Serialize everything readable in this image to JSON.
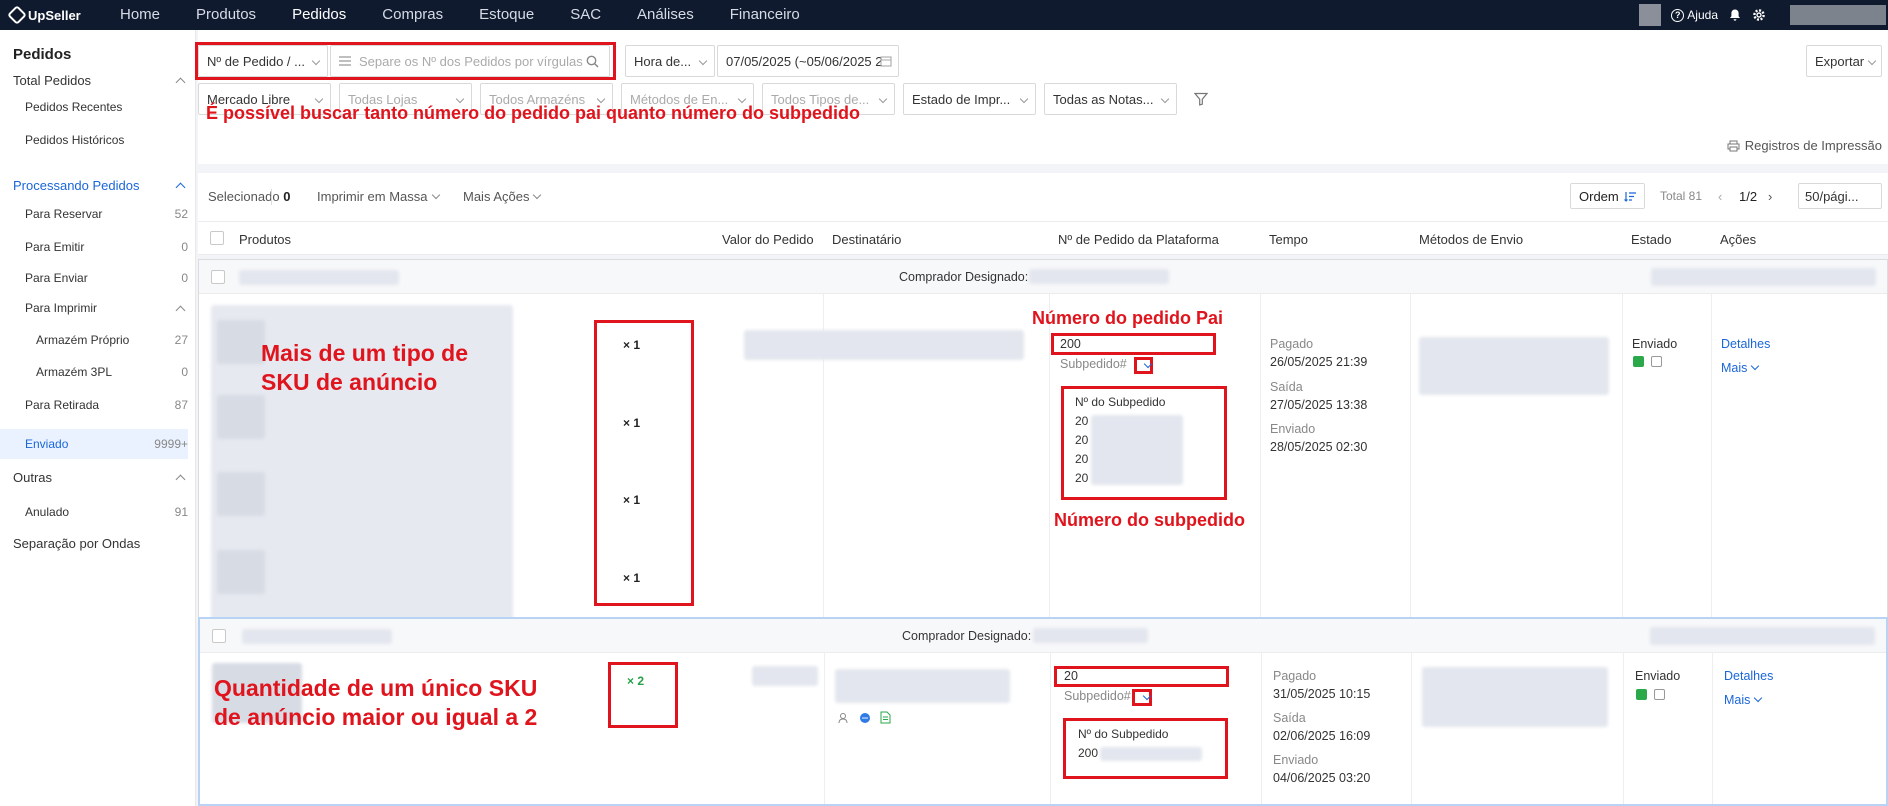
{
  "nav": {
    "logo": "UpSeller",
    "items": [
      "Home",
      "Produtos",
      "Pedidos",
      "Compras",
      "Estoque",
      "SAC",
      "Análises",
      "Financeiro"
    ],
    "active": "Pedidos",
    "help": "Ajuda"
  },
  "sidebar": {
    "title": "Pedidos",
    "total": "Total Pedidos",
    "recentes": "Pedidos Recentes",
    "historicos": "Pedidos Históricos",
    "processando": "Processando Pedidos",
    "reservar": {
      "label": "Para Reservar",
      "count": "52"
    },
    "emitir": {
      "label": "Para Emitir",
      "count": "0"
    },
    "enviar": {
      "label": "Para Enviar",
      "count": "0"
    },
    "imprimir": "Para Imprimir",
    "armazem_proprio": {
      "label": "Armazém Próprio",
      "count": "27"
    },
    "armazem_3pl": {
      "label": "Armazém 3PL",
      "count": "0"
    },
    "retirada": {
      "label": "Para Retirada",
      "count": "87"
    },
    "enviado": {
      "label": "Enviado",
      "count": "9999+"
    },
    "outras": "Outras",
    "anulado": {
      "label": "Anulado",
      "count": "91"
    },
    "ondas": "Separação por Ondas"
  },
  "filters": {
    "search_type": "Nº de Pedido / ...",
    "search_placeholder": "Separe os Nº dos Pedidos por vírgulas",
    "time_type": "Hora de...",
    "date_range": "07/05/2025 (~05/06/2025 2",
    "export": "Exportar",
    "marketplace": "Mercado Libre",
    "stores": "Todas Lojas",
    "warehouses": "Todos Armazéns",
    "shipping": "Métodos de En...",
    "types": "Todos Tipos de...",
    "print_state": "Estado de Impr...",
    "invoices": "Todas as Notas..."
  },
  "annotations": {
    "search_note": "É possível buscar tanto número do pedido pai quanto número do subpedido",
    "multi_sku": [
      "Mais de um tipo de",
      "SKU de anúncio"
    ],
    "parent_order": "Número do pedido Pai",
    "sub_order": "Número do subpedido",
    "single_sku": [
      "Quantidade de um único SKU",
      "de anúncio maior ou igual a 2"
    ]
  },
  "print_log": "Registros de Impressão",
  "toolbar": {
    "selected_label": "Selecionado",
    "selected_count": "0",
    "bulk_print": "Imprimir em Massa",
    "more_actions": "Mais Ações",
    "sort": "Ordem",
    "total": "Total 81",
    "page": "1/2",
    "per_page": "50/pági..."
  },
  "columns": [
    "Produtos",
    "Valor do Pedido",
    "Destinatário",
    "Nº de Pedido da Plataforma",
    "Tempo",
    "Métodos de Envio",
    "Estado",
    "Ações"
  ],
  "orders": [
    {
      "buyer_label": "Comprador Designado:",
      "quantities": [
        "× 1",
        "× 1",
        "× 1",
        "× 1"
      ],
      "order_no": "200",
      "sub_label": "Subpedido#",
      "sub_header": "Nº do Subpedido",
      "sub_numbers": [
        "20",
        "20",
        "20",
        "20"
      ],
      "times": [
        {
          "label": "Pagado",
          "value": "26/05/2025 21:39"
        },
        {
          "label": "Saída",
          "value": "27/05/2025 13:38"
        },
        {
          "label": "Enviado",
          "value": "28/05/2025 02:30"
        }
      ],
      "status": "Enviado",
      "details": "Detalhes",
      "more": "Mais"
    },
    {
      "buyer_label": "Comprador Designado:",
      "quantities": [
        "× 2"
      ],
      "order_no": "20",
      "sub_label": "Subpedido#",
      "sub_header": "Nº do Subpedido",
      "sub_numbers": [
        "200"
      ],
      "times": [
        {
          "label": "Pagado",
          "value": "31/05/2025 10:15"
        },
        {
          "label": "Saída",
          "value": "02/06/2025 16:09"
        },
        {
          "label": "Enviado",
          "value": "04/06/2025 03:20"
        }
      ],
      "status": "Enviado",
      "details": "Detalhes",
      "more": "Mais"
    }
  ]
}
